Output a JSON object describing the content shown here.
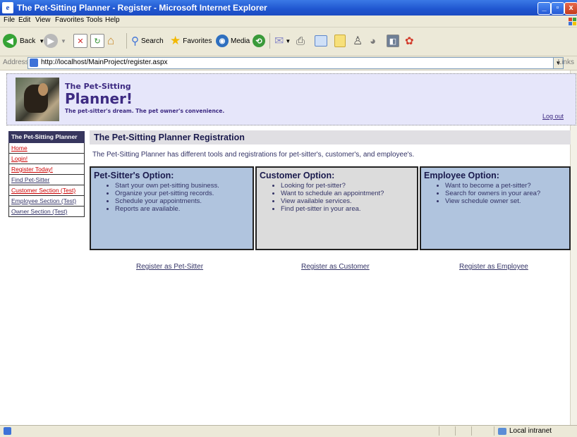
{
  "window": {
    "title": "The Pet-Sitting Planner - Register - Microsoft Internet Explorer"
  },
  "menu": [
    "File",
    "Edit",
    "View",
    "Favorites",
    "Tools",
    "Help"
  ],
  "toolbar": {
    "back": "Back",
    "search": "Search",
    "favorites": "Favorites",
    "media": "Media"
  },
  "address": {
    "label": "Address",
    "url": "http://localhost/MainProject/register.aspx",
    "links": "Links"
  },
  "status": {
    "zone": "Local intranet"
  },
  "header": {
    "small_title": "The Pet-Sitting",
    "big_title": "Planner!",
    "tagline": "The pet-sitter's dream. The pet owner's convenience.",
    "logout": "Log out"
  },
  "sidebar": {
    "heading": "The Pet-Sitting Planner",
    "items": [
      {
        "label": "Home",
        "color": "#cc0000"
      },
      {
        "label": "Login!",
        "color": "#cc0000"
      },
      {
        "label": "Register Today!",
        "color": "#cc0000"
      },
      {
        "label": "Find Pet-Sitter",
        "color": "#333366"
      },
      {
        "label": "Customer Section (Test)",
        "color": "#cc0000"
      },
      {
        "label": "Employee Section (Test)",
        "color": "#333366"
      },
      {
        "label": "Owner Section (Test)",
        "color": "#333366"
      }
    ]
  },
  "main": {
    "title": "The Pet-Sitting Planner Registration",
    "intro": "The Pet-Sitting Planner has different tools and registrations for pet-sitter's, customer's, and employee's.",
    "options": [
      {
        "title": "Pet-Sitter's Option:",
        "bullets": [
          "Start your own pet-sitting business.",
          "Organize your pet-sitting records.",
          "Schedule your appointments.",
          "Reports are available."
        ],
        "link": "Register as Pet-Sitter"
      },
      {
        "title": "Customer Option:",
        "bullets": [
          "Looking for pet-sitter?",
          "Want to schedule an appointment?",
          "View available services.",
          "Find pet-sitter in your area."
        ],
        "link": "Register as Customer"
      },
      {
        "title": "Employee Option:",
        "bullets": [
          "Want to become a pet-sitter?",
          "Search for owners in your area?",
          "View schedule owner set."
        ],
        "link": "Register as Employee"
      }
    ]
  }
}
